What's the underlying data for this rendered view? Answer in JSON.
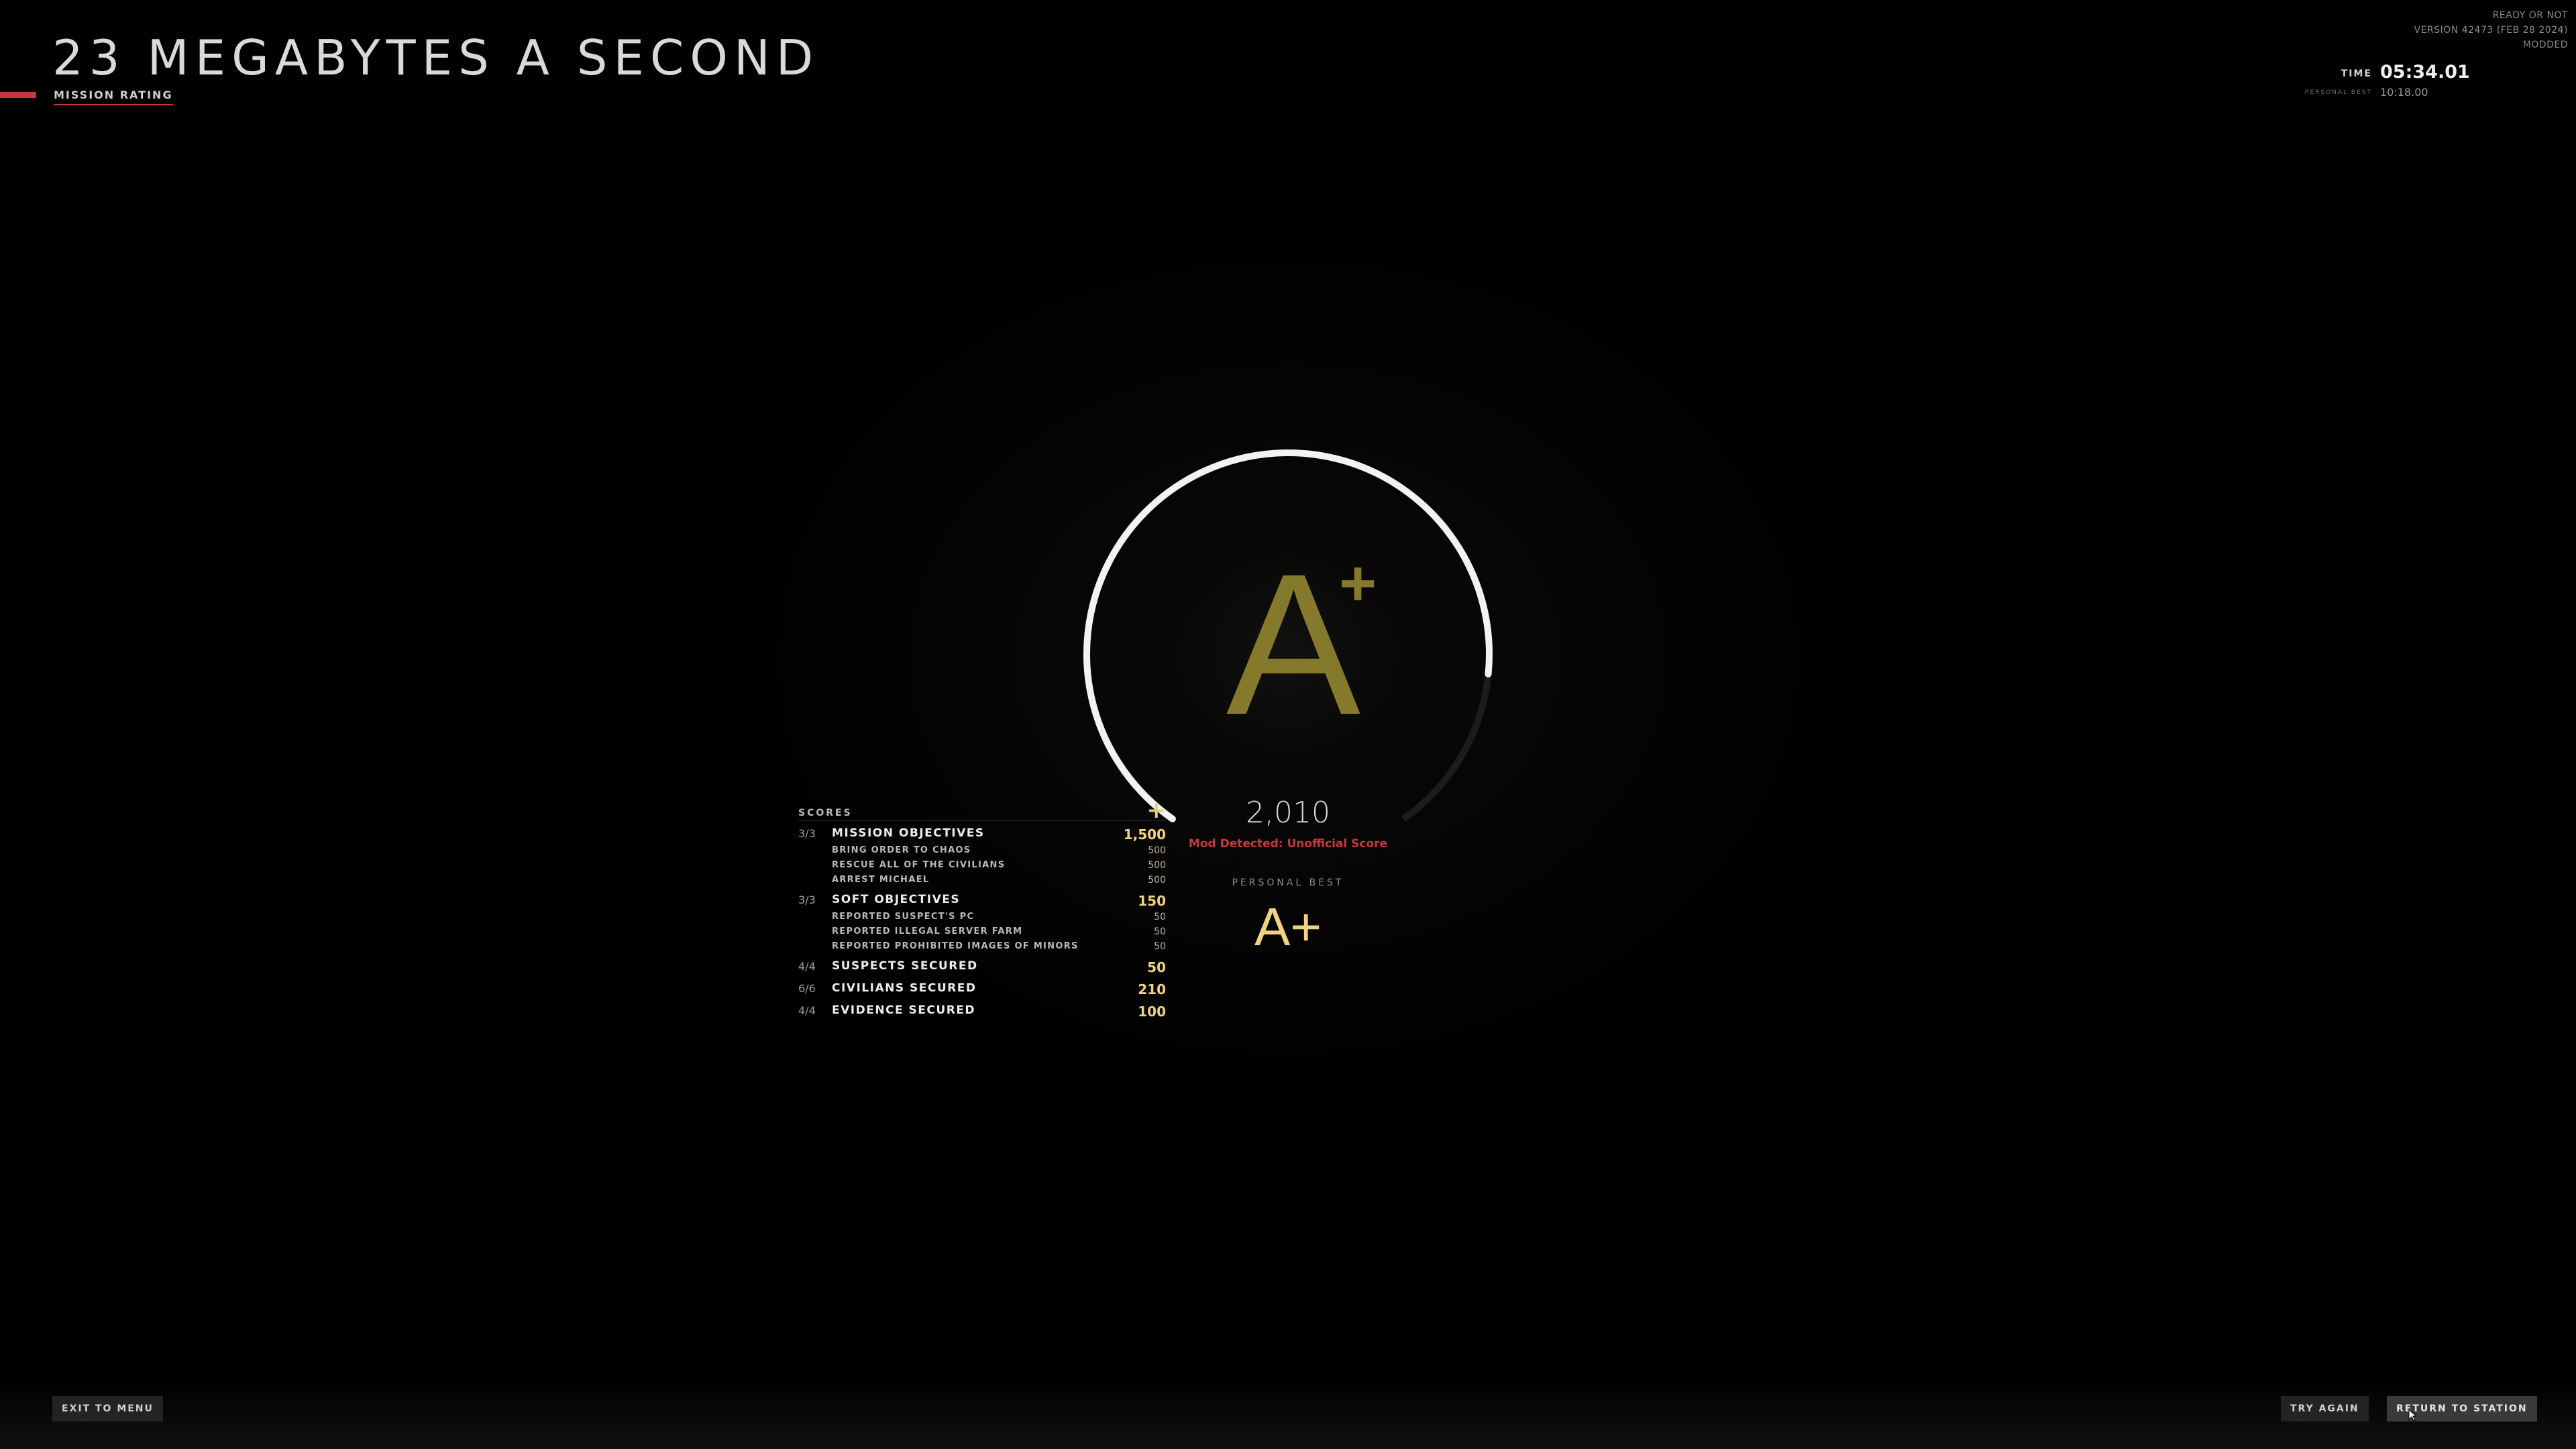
{
  "header": {
    "title": "23 MEGABYTES A SECOND",
    "subtitle": "MISSION RATING"
  },
  "build_info": {
    "game": "READY OR NOT",
    "version": "VERSION 42473 (FEB 28 2024)",
    "status": "MODDED"
  },
  "timer": {
    "time_label": "TIME",
    "time_value": "05:34.01",
    "pb_label": "PERSONAL BEST",
    "pb_value": "10:18.00"
  },
  "grade": {
    "letter": "A",
    "modifier": "+",
    "ring_fill_fraction": 0.83,
    "color": "#857a2c"
  },
  "score": {
    "total": "2,010",
    "mod_warning": "Mod Detected: Unofficial Score",
    "personal_best_label": "PERSONAL BEST",
    "personal_best_grade": "A+"
  },
  "scores_panel": {
    "title": "SCORES",
    "toggle_icon": "+",
    "rows": [
      {
        "fraction": "3/3",
        "name": "MISSION OBJECTIVES",
        "value": "1,500",
        "kind": "main"
      },
      {
        "fraction": "",
        "name": "BRING ORDER TO CHAOS",
        "value": "500",
        "kind": "sub"
      },
      {
        "fraction": "",
        "name": "RESCUE ALL OF THE CIVILIANS",
        "value": "500",
        "kind": "sub"
      },
      {
        "fraction": "",
        "name": "ARREST MICHAEL",
        "value": "500",
        "kind": "sub"
      },
      {
        "fraction": "3/3",
        "name": "SOFT OBJECTIVES",
        "value": "150",
        "kind": "main"
      },
      {
        "fraction": "",
        "name": "REPORTED SUSPECT'S PC",
        "value": "50",
        "kind": "sub"
      },
      {
        "fraction": "",
        "name": "REPORTED ILLEGAL SERVER FARM",
        "value": "50",
        "kind": "sub"
      },
      {
        "fraction": "",
        "name": "REPORTED PROHIBITED IMAGES OF MINORS",
        "value": "50",
        "kind": "sub"
      },
      {
        "fraction": "4/4",
        "name": "SUSPECTS SECURED",
        "value": "50",
        "kind": "main"
      },
      {
        "fraction": "6/6",
        "name": "CIVILIANS SECURED",
        "value": "210",
        "kind": "main"
      },
      {
        "fraction": "4/4",
        "name": "EVIDENCE SECURED",
        "value": "100",
        "kind": "main"
      }
    ]
  },
  "buttons": {
    "exit": "EXIT TO MENU",
    "try_again": "TRY AGAIN",
    "return": "RETURN TO STATION"
  },
  "colors": {
    "accent_red": "#c8373a",
    "score_gold": "#f1d27d",
    "grade_olive": "#857a2c"
  }
}
